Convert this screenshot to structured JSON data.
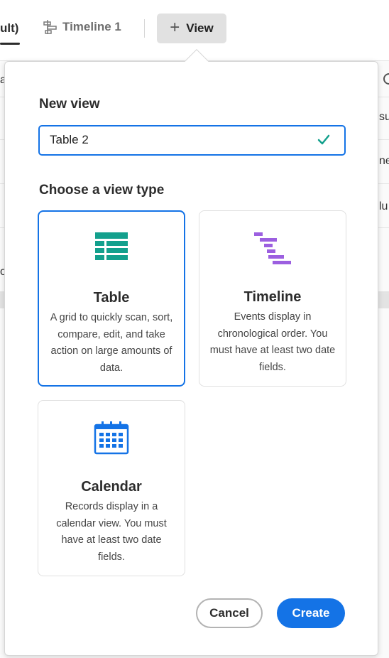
{
  "tabs": {
    "default_label": "ult)",
    "timeline_label": "Timeline 1",
    "add_view_label": "View"
  },
  "background": {
    "fragments": [
      "a",
      "su",
      "ne",
      "lu",
      "or"
    ]
  },
  "dialog": {
    "new_view_heading": "New view",
    "name_value": "Table 2",
    "choose_heading": "Choose a view type",
    "view_types": [
      {
        "title": "Table",
        "description": "A grid to quickly scan, sort, compare, edit, and take action on large amounts of data.",
        "icon": "table-icon",
        "selected": true
      },
      {
        "title": "Timeline",
        "description": "Events display in chronological order. You must have at least two date fields.",
        "icon": "timeline-icon",
        "selected": false
      },
      {
        "title": "Calendar",
        "description": "Records display in a calendar view. You must have at least two date fields.",
        "icon": "calendar-icon",
        "selected": false
      }
    ],
    "cancel_label": "Cancel",
    "create_label": "Create"
  },
  "colors": {
    "accent": "#1473e6",
    "table_icon": "#13a08d",
    "timeline_icon": "#9c5fe0",
    "calendar_icon": "#1473e6",
    "check": "#13a08d"
  }
}
